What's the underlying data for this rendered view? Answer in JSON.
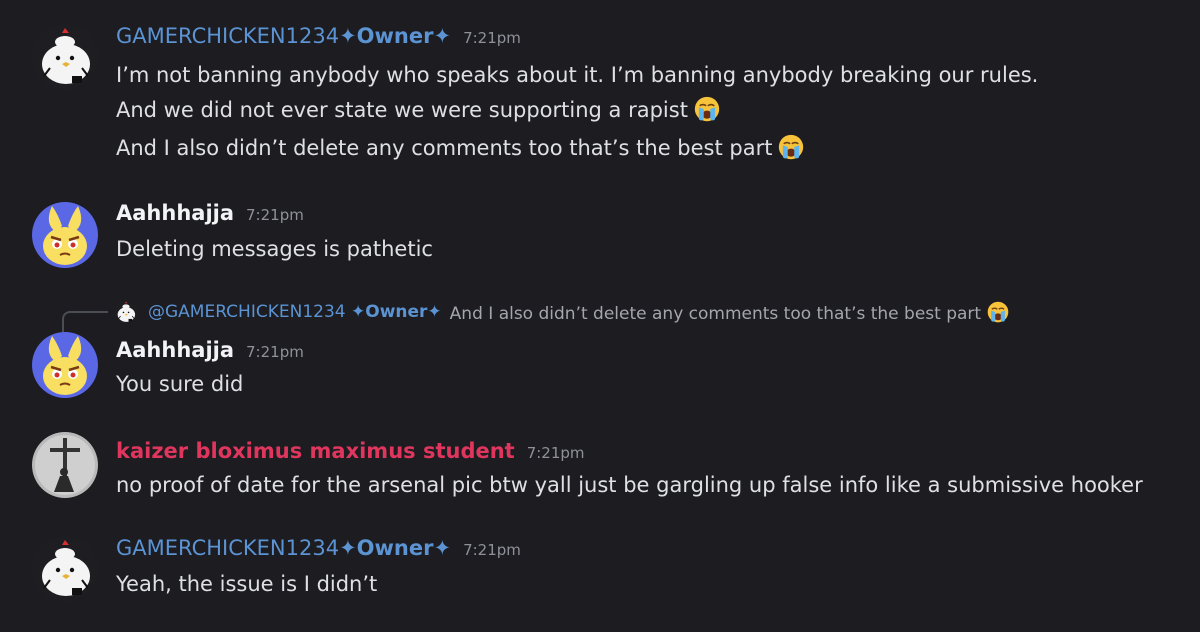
{
  "messages": [
    {
      "author": "GAMERCHICKEN1234",
      "role": "✦Owner✦",
      "time": "7:21pm",
      "lines": [
        "I’m not banning anybody who speaks about it. I’m banning anybody breaking our rules.",
        "And we did not ever state we were supporting a rapist",
        "And I also didn’t delete any comments too that’s the best part"
      ],
      "line_emoji": [
        "",
        "loudly-crying-face-icon",
        "loudly-crying-face-icon"
      ]
    },
    {
      "author": "Aahhhajja",
      "time": "7:21pm",
      "lines": [
        "Deleting messages is pathetic"
      ]
    },
    {
      "reply": {
        "user": "@GAMERCHICKEN1234",
        "role": "✦Owner✦",
        "text": "And I also didn’t delete any comments too that’s the best part",
        "emoji": "loudly-crying-face-icon"
      },
      "author": "Aahhhajja",
      "time": "7:21pm",
      "lines": [
        "You sure did"
      ]
    },
    {
      "author": "kaizer bloximus maximus student",
      "time": "7:21pm",
      "lines": [
        "no proof of date for the arsenal pic btw yall just be gargling up false info like a submissive hooker"
      ]
    },
    {
      "author": "GAMERCHICKEN1234",
      "role": "✦Owner✦",
      "time": "7:21pm",
      "lines": [
        "Yeah, the issue is I didn’t"
      ]
    }
  ],
  "colors": {
    "background": "#1c1c21",
    "owner_name": "#5b93d3",
    "kaizer_name": "#e0365e",
    "text": "#dfe0e4",
    "timestamp": "#8f919a"
  }
}
